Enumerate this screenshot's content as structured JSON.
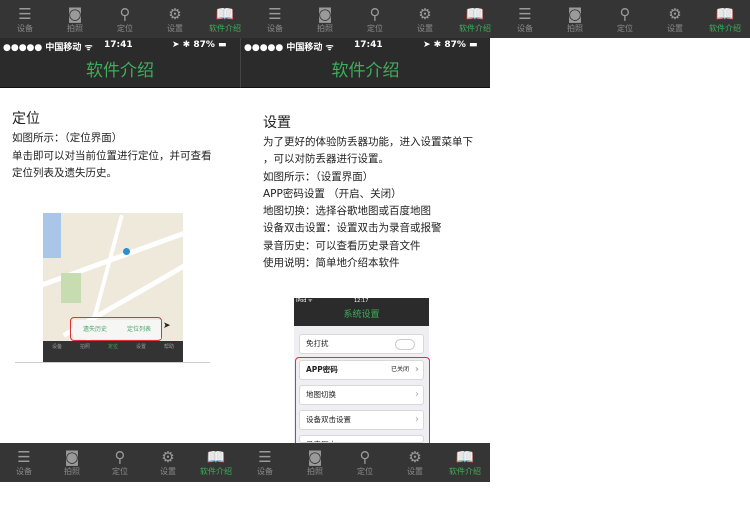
{
  "tabs": [
    {
      "label": "设备",
      "icon": "list-icon",
      "glyph": "☰"
    },
    {
      "label": "拍照",
      "icon": "camera-icon",
      "glyph": "◙"
    },
    {
      "label": "定位",
      "icon": "location-pin-icon",
      "glyph": "⚲"
    },
    {
      "label": "设置",
      "icon": "gear-icon",
      "glyph": "⚙"
    },
    {
      "label": "软件介绍",
      "icon": "book-icon",
      "glyph": "📖"
    }
  ],
  "active_tab": "软件介绍",
  "accent": "#3fae5a",
  "status": {
    "carrier": "●●●●● 中国移动 ᯤ",
    "time": "17:41",
    "battery": "➤ ✱ 87% ▬"
  },
  "title": "软件介绍",
  "panel1": {
    "heading": "定位",
    "lines": [
      "如图所示：（定位界面）",
      "单击即可以对当前位置进行定位，并可查看",
      "定位列表及遗失历史。"
    ],
    "map_buttons": [
      "遗失历史",
      "定位列表"
    ],
    "mini_tabs": [
      "设备",
      "拍照",
      "定位",
      "设置",
      "帮助"
    ]
  },
  "panel2": {
    "heading": "设置",
    "lines": [
      "为了更好的体验防丢器功能，进入设置菜单下",
      "，可以对防丢器进行设置。",
      "如图所示：（设置界面）",
      "APP密码设置 （开启、关闭）",
      "地图切换：选择谷歌地图或百度地图",
      "设备双击设置：设置双击为录音或报警",
      "录音历史：可以查看历史录音文件",
      "使用说明：简单地介绍本软件"
    ],
    "shot": {
      "status_left": "iPod ᯤ",
      "status_time": "12:17",
      "title": "系统设置",
      "rows": [
        {
          "label": "免打扰",
          "value": ""
        },
        {
          "label": "APP密码",
          "value": "已关闭"
        },
        {
          "label": "地图切换",
          "value": ""
        },
        {
          "label": "设备双击设置",
          "value": ""
        },
        {
          "label": "录音历史",
          "value": ""
        }
      ]
    }
  }
}
